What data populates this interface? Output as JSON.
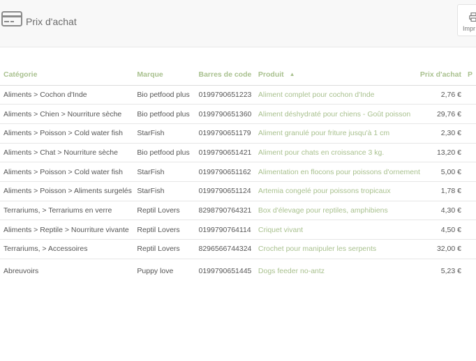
{
  "header": {
    "title": "Prix d'achat",
    "print_label": "Impr"
  },
  "colors": {
    "accent": "#a9c18f",
    "text": "#555555",
    "header_bg": "#f8f8f8"
  },
  "table": {
    "columns": {
      "category": "Catégorie",
      "brand": "Marque",
      "barcode": "Barres de code",
      "product": "Produit",
      "price": "Prix d'achat",
      "extra": "P"
    },
    "sort_indicator": "▲",
    "rows": [
      {
        "category": "Aliments > Cochon d'Inde",
        "brand": "Bio petfood plus",
        "barcode": "0199790651223",
        "product": "Aliment complet pour cochon d'Inde",
        "price": "2,76 €"
      },
      {
        "category": "Aliments > Chien > Nourriture sèche",
        "brand": "Bio petfood plus",
        "barcode": "0199790651360",
        "product": "Aliment déshydraté pour chiens - Goût poisson",
        "price": "29,76 €"
      },
      {
        "category": "Aliments > Poisson > Cold water fish",
        "brand": "StarFish",
        "barcode": "0199790651179",
        "product": "Aliment granulé pour friture jusqu'à 1 cm",
        "price": "2,30 €"
      },
      {
        "category": "Aliments > Chat > Nourriture sèche",
        "brand": "Bio petfood plus",
        "barcode": "0199790651421",
        "product": "Aliment pour chats en croissance 3 kg.",
        "price": "13,20 €"
      },
      {
        "category": "Aliments > Poisson > Cold water fish",
        "brand": "StarFish",
        "barcode": "0199790651162",
        "product": "Alimentation en flocons pour poissons d'ornement",
        "price": "5,00 €"
      },
      {
        "category": "Aliments > Poisson > Aliments surgelés",
        "brand": "StarFish",
        "barcode": "0199790651124",
        "product": "Artemia congelé pour poissons tropicaux",
        "price": "1,78 €"
      },
      {
        "category": "Terrariums, > Terrariums en verre",
        "brand": "Reptil Lovers",
        "barcode": "8298790764321",
        "product": "Box d'élevage pour reptiles, amphibiens",
        "price": "4,30 €"
      },
      {
        "category": "Aliments > Reptile > Nourriture vivante",
        "brand": "Reptil Lovers",
        "barcode": "0199790764114",
        "product": "Criquet vivant",
        "price": "4,50 €"
      },
      {
        "category": "Terrariums, > Accessoires",
        "brand": "Reptil Lovers",
        "barcode": "8296566744324",
        "product": "Crochet pour manipuler les serpents",
        "price": "32,00 €"
      },
      {
        "category": "Abreuvoirs",
        "brand": "Puppy love",
        "barcode": "0199790651445",
        "product": "Dogs feeder no-antz",
        "price": "5,23 €"
      }
    ]
  }
}
